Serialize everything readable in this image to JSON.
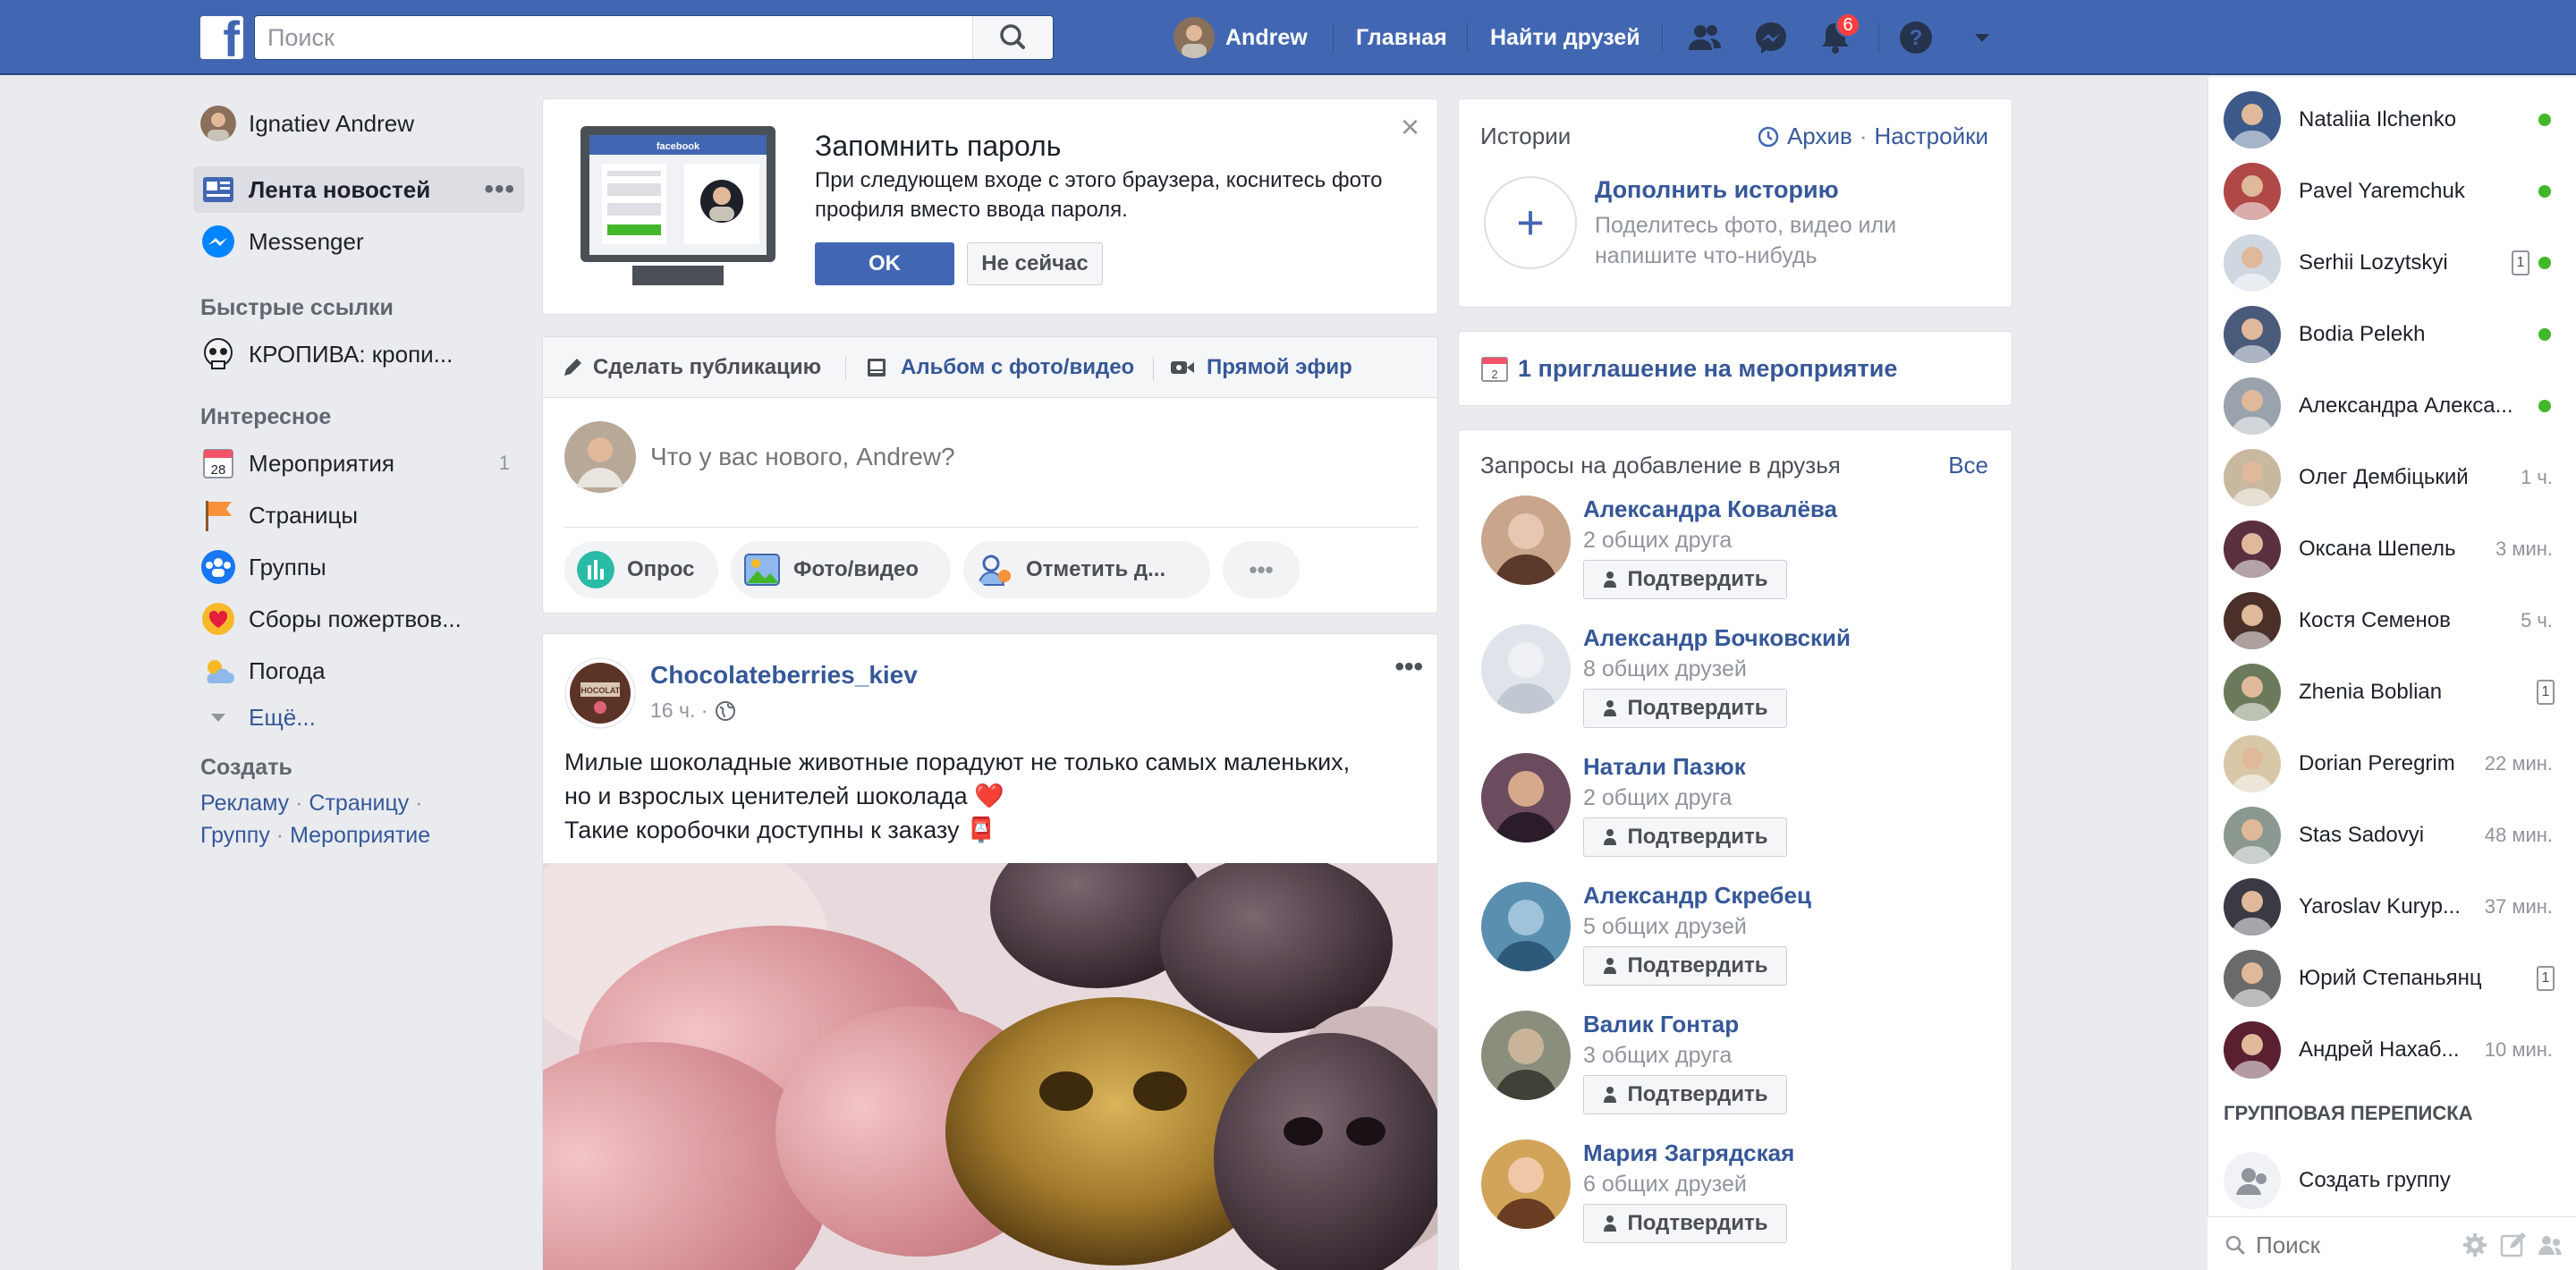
{
  "topbar": {
    "logo": "f",
    "search_placeholder": "Поиск",
    "user_name": "Andrew",
    "nav_home": "Главная",
    "nav_find_friends": "Найти друзей",
    "notifications_count": "6",
    "icons": [
      "friends-icon",
      "messenger-icon",
      "notifications-icon",
      "help-icon",
      "account-menu-icon"
    ],
    "brand_color": "#4267b2"
  },
  "left": {
    "profile_name": "Ignatiev Andrew",
    "news_feed": "Лента новостей",
    "news_feed_more": "•••",
    "messenger": "Messenger",
    "shortcuts_title": "Быстрые ссылки",
    "shortcut_1": "КРОПИВА: кропи...",
    "explore_title": "Интересное",
    "events": "Мероприятия",
    "events_count": "1",
    "pages": "Страницы",
    "groups": "Группы",
    "fundraisers": "Сборы пожертвов...",
    "weather": "Погода",
    "more": "Ещё...",
    "create_title": "Создать",
    "create_ad": "Рекламу",
    "create_page": "Страницу",
    "create_group": "Группу",
    "create_event": "Мероприятие",
    "dot": "·"
  },
  "password_card": {
    "title": "Запомнить пароль",
    "text": "При следующем входе с этого браузера, коснитесь фото профиля вместо ввода пароля.",
    "ok": "OK",
    "not_now": "Не сейчас",
    "close": "×",
    "illustration_brand": "facebook"
  },
  "composer": {
    "tab_post": "Сделать публикацию",
    "tab_album": "Альбом с фото/видео",
    "tab_live": "Прямой эфир",
    "placeholder": "Что у вас нового, Andrew?",
    "btn_poll": "Опрос",
    "btn_photo": "Фото/видео",
    "btn_tag": "Отметить д...",
    "btn_more": "•••"
  },
  "post": {
    "author": "Chocolateberries_kiev",
    "time": "16 ч. ·",
    "more": "•••",
    "line1": "Милые шоколадные животные порадуют не только самых маленьких,",
    "line2": "но и взрослых ценителей шоколада ❤️",
    "line3": "Такие коробочки доступны к заказу 📮"
  },
  "stories": {
    "title": "Истории",
    "archive": "Архив",
    "dot": "·",
    "settings": "Настройки",
    "add_title": "Дополнить историю",
    "add_text_1": "Поделитесь фото, видео или",
    "add_text_2": "напишите что-нибудь",
    "add_icon": "+"
  },
  "events_card": {
    "text": "1 приглашение на мероприятие",
    "day": "2"
  },
  "friend_requests": {
    "title": "Запросы на добавление в друзья",
    "all": "Все",
    "confirm": "Подтвердить",
    "items": [
      {
        "name": "Александра Ковалёва",
        "mutual": "2 общих друга"
      },
      {
        "name": "Александр Бочковский",
        "mutual": "8 общих друзей"
      },
      {
        "name": "Натали Пазюк",
        "mutual": "2 общих друга"
      },
      {
        "name": "Александр Скребец",
        "mutual": "5 общих друзей"
      },
      {
        "name": "Валик Гонтар",
        "mutual": "3 общих друга"
      },
      {
        "name": "Мария Загрядская",
        "mutual": "6 общих друзей"
      }
    ]
  },
  "chat": {
    "contacts": [
      {
        "name": "Nataliia Ilchenko",
        "status": ""
      },
      {
        "name": "Pavel Yaremchuk",
        "status": ""
      },
      {
        "name": "Serhii Lozytskyi",
        "status": "1"
      },
      {
        "name": "Bodia Pelekh",
        "status": ""
      },
      {
        "name": "Александра Алекса...",
        "status": ""
      },
      {
        "name": "Олег Дембіцький",
        "status": "1 ч."
      },
      {
        "name": "Оксана Шепель",
        "status": "3 мин."
      },
      {
        "name": "Костя Семенов",
        "status": "5 ч."
      },
      {
        "name": "Zhenia Boblian",
        "status": "1"
      },
      {
        "name": "Dorian Peregrim",
        "status": "22 мин."
      },
      {
        "name": "Stas Sadovyi",
        "status": "48 мин."
      },
      {
        "name": "Yaroslav Kuryp...",
        "status": "37 мин."
      },
      {
        "name": "Юрий Степаньянц",
        "status": "1"
      },
      {
        "name": "Андрей Нахаб...",
        "status": "10 мин."
      }
    ],
    "group_title": "ГРУППОВАЯ ПЕРЕПИСКА",
    "create_group": "Создать группу",
    "search_placeholder": "Поиск"
  }
}
